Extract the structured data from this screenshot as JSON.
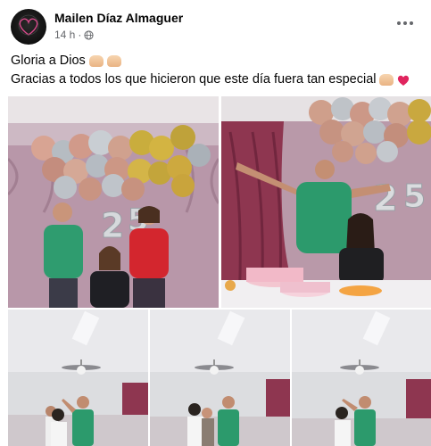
{
  "post": {
    "author": "Mailen Díaz Almaguer",
    "time": "14 h",
    "separator": "·",
    "line1": "Gloria a Dios",
    "line2": "Gracias a todos los que hicieron que este día fuera tan especial"
  },
  "icons": {
    "more": "more-options-icon",
    "audience": "globe-icon",
    "emoji_hands": "praying-hands-emoji",
    "emoji_heart": "red-heart-emoji"
  },
  "colors": {
    "text_primary": "#050505",
    "text_secondary": "#65676b",
    "heart": "#e0245e"
  }
}
